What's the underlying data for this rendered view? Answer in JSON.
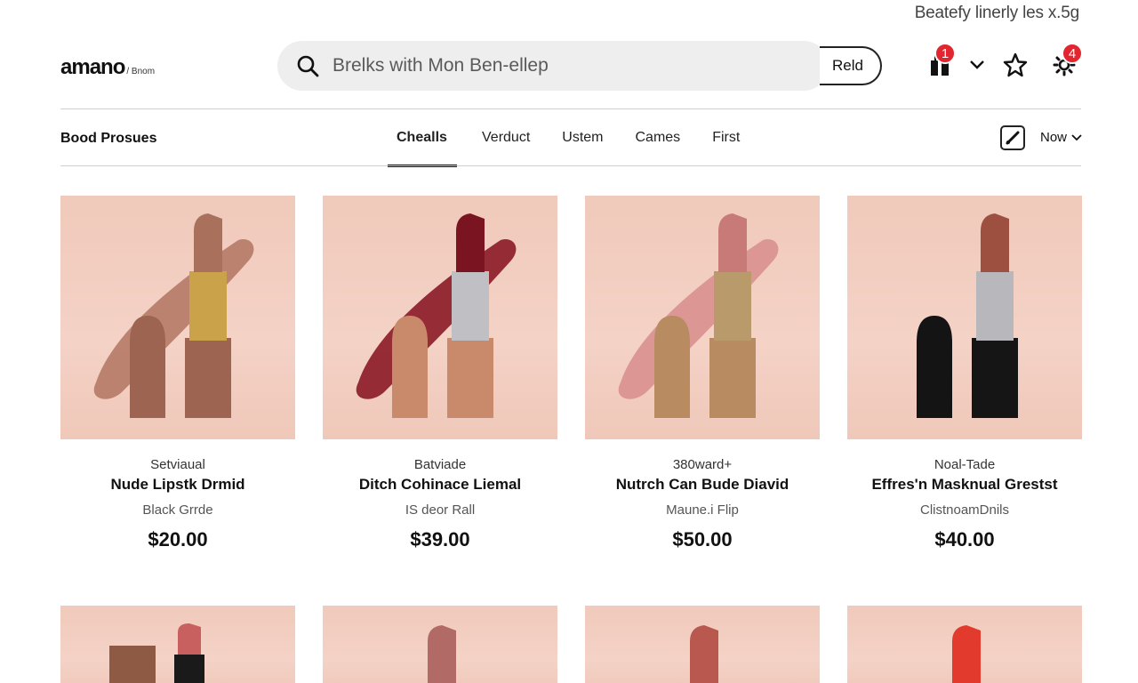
{
  "top_banner": "Beatefy linerly les x.5g",
  "header": {
    "logo": "amano",
    "logo_sub": "/ Bnom",
    "search_placeholder": "Brelks with Mon Ben-ellep",
    "search_button": "Reld",
    "cart_badge": "1",
    "settings_badge": "4",
    "icons": [
      "bag-icon",
      "chevron-down-icon",
      "star-icon",
      "gear-icon"
    ]
  },
  "category_bar": {
    "title": "Bood Prosues",
    "tabs": [
      "Chealls",
      "Verduct",
      "Ustem",
      "Cames",
      "First"
    ],
    "active_tab": 0,
    "sort_label": "Now"
  },
  "products": [
    {
      "brand": "Setviaual",
      "name": "Nude Lipstk Drmid",
      "shade": "Black Grrde",
      "price": "$20.00",
      "bullet": "#a9705c",
      "cap": "#9c6451",
      "swatch": "#b57a66",
      "band": "#c9a24a"
    },
    {
      "brand": "Batviade",
      "name": "Ditch Cohinace Liemal",
      "shade": "IS deor Rall",
      "price": "$39.00",
      "bullet": "#7a1420",
      "cap": "#c98a6c",
      "swatch": "#8b1a26",
      "band": "#c0c0c4"
    },
    {
      "brand": "380ward+",
      "name": "Nutrch Can Bude Diavid",
      "shade": "Maune.i Flip",
      "price": "$50.00",
      "bullet": "#c77a78",
      "cap": "#b88b60",
      "swatch": "#d9908f",
      "band": "#b99a6a"
    },
    {
      "brand": "Noal-Tade",
      "name": "Effres'n Masknual Grestst",
      "shade": "ClistnoamDnils",
      "price": "$40.00",
      "bullet": "#9e5040",
      "cap": "#141414",
      "swatch": "",
      "band": "#b8b8bc"
    }
  ],
  "row2": [
    {
      "bullet": "#c86060",
      "cap": "#8e5a44"
    },
    {
      "bullet": "#b26a66",
      "cap": ""
    },
    {
      "bullet": "#b8584e",
      "cap": ""
    },
    {
      "bullet": "#e23a2c",
      "cap": ""
    }
  ],
  "colors": {
    "accent": "#111111",
    "badge": "#e22630",
    "tile_bg": "#f2cfc2"
  }
}
